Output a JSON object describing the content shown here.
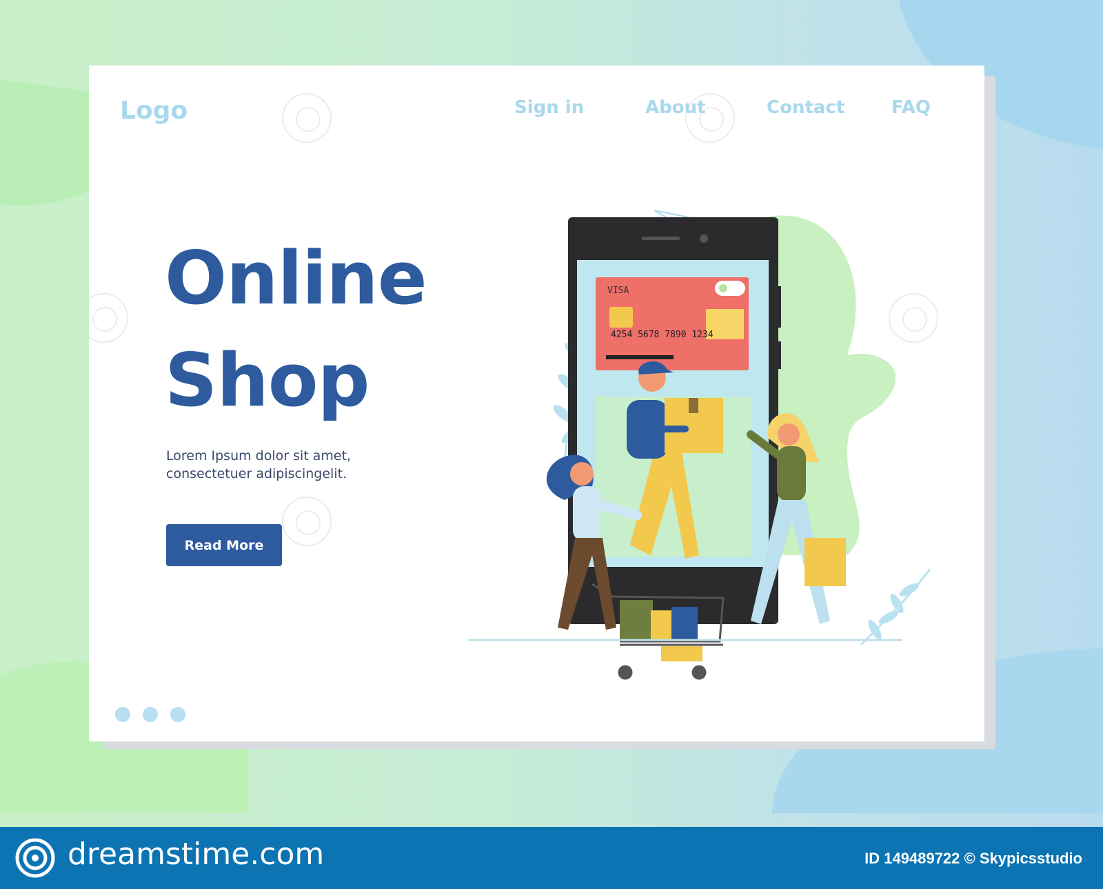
{
  "header": {
    "logo": "Logo",
    "nav": [
      "Sign in",
      "About",
      "Contact",
      "FAQ"
    ]
  },
  "hero": {
    "title_line1": "Online",
    "title_line2": "Shop",
    "text_line1": "Lorem Ipsum dolor sit amet,",
    "text_line2": "consectetuer adipiscingelit.",
    "button": "Read More"
  },
  "slider": {
    "dots": 3
  },
  "illustration": {
    "card_brand": "VISA",
    "card_number": "4254 5678 7890 1234"
  },
  "footer": {
    "brand": "dreamstime.com",
    "id_text": "ID 149489722 © Skypicsstudio"
  },
  "colors": {
    "primary": "#2e5b9e",
    "nav": "#a9d8ec",
    "footer": "#0c74b3"
  }
}
